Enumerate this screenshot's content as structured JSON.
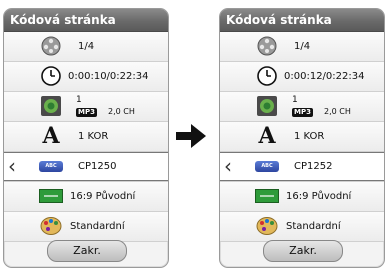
{
  "panels": [
    {
      "title": "Kódová stránka",
      "title_number": "1/4",
      "time": "0:00:10/0:22:34",
      "audio_track": "1",
      "audio_format": "MP3",
      "audio_channels": "2,0 CH",
      "subtitle_language": "1 KOR",
      "code_page": "CP1250",
      "aspect_ratio": "16:9 Původní",
      "picture_mode": "Standardní",
      "close_label": "Zakr."
    },
    {
      "title": "Kódová stránka",
      "title_number": "1/4",
      "time": "0:00:12/0:22:34",
      "audio_track": "1",
      "audio_format": "MP3",
      "audio_channels": "2,0 CH",
      "subtitle_language": "1 KOR",
      "code_page": "CP1252",
      "aspect_ratio": "16:9 Původní",
      "picture_mode": "Standardní",
      "close_label": "Zakr."
    }
  ],
  "icons": {
    "row1": "film-reel-icon",
    "row2": "clock-icon",
    "row3": "speaker-icon",
    "row4": "font-a-icon",
    "row5": "abc-code-icon",
    "row6": "aspect-ratio-icon",
    "row7": "palette-icon",
    "nav": "chevron-left-icon",
    "transition": "arrow-right-icon"
  },
  "abc_icon_text": "ABC",
  "colors": {
    "title_bar": "#6a6a6a",
    "accent_green": "#2e9b3a",
    "accent_blue": "#2d46a0"
  }
}
